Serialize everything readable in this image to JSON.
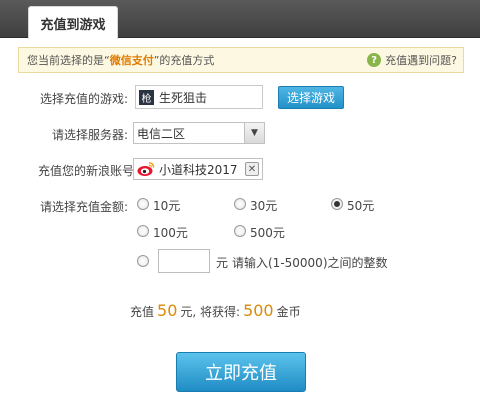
{
  "header": {
    "tab_label": "充值到游戏"
  },
  "notice": {
    "prefix": "您当前选择的是“",
    "method": "微信支付",
    "suffix": "”的充值方式",
    "help_text": "充值遇到问题?"
  },
  "form": {
    "game_label": "选择充值的游戏:",
    "game_icon_char": "枪",
    "game_value": "生死狙击",
    "select_game_button": "选择游戏",
    "server_label": "请选择服务器:",
    "server_value": "电信二区",
    "account_label": "充值您的新浪账号",
    "account_value": "小道科技2017",
    "amount_label": "请选择充值金额:",
    "amounts": [
      {
        "label": "10元",
        "checked": false
      },
      {
        "label": "30元",
        "checked": false
      },
      {
        "label": "50元",
        "checked": true
      },
      {
        "label": "100元",
        "checked": false
      },
      {
        "label": "500元",
        "checked": false
      }
    ],
    "custom_unit": "元",
    "custom_hint": "请输入(1-50000)之间的整数"
  },
  "summary": {
    "prefix": "充值",
    "amount": "50",
    "middle": "元, 将获得:",
    "coins": "500",
    "suffix": "金币"
  },
  "submit_button": "立即充值",
  "colors": {
    "accent": "#1f8cc4",
    "highlight": "#d98b0a",
    "pay_method": "#e07b00"
  }
}
